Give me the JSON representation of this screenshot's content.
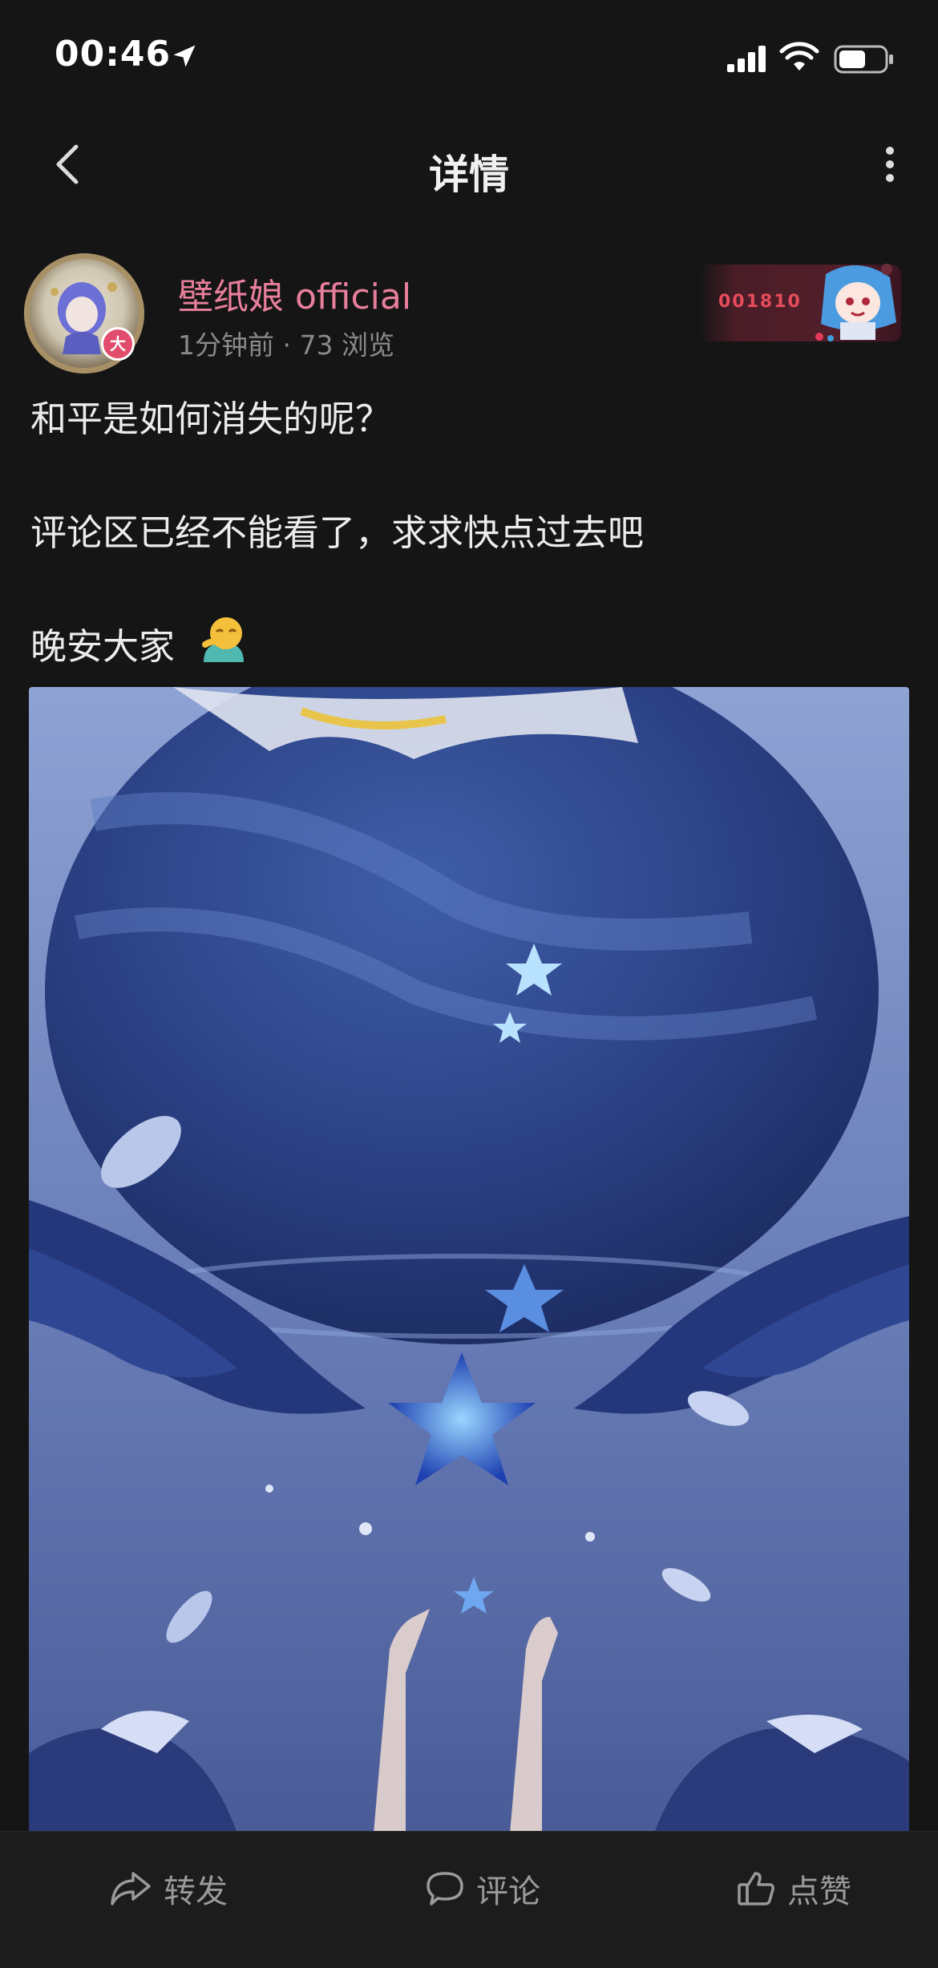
{
  "status_bar": {
    "time": "00:46",
    "battery_level": 0.6
  },
  "nav": {
    "title": "详情",
    "back_icon": "chevron-left-icon",
    "more_icon": "more-vertical-icon"
  },
  "author": {
    "name": "壁纸娘 official",
    "name_color": "#e87f9c",
    "badge": "大",
    "meta": "1分钟前 · 73 浏览",
    "medal_text": "001810"
  },
  "post": {
    "lines": [
      "和平是如何消失的呢？",
      "评论区已经不能看了，求求快点过去吧",
      "晚安大家"
    ],
    "emoji": "hugging-emoji"
  },
  "actions": {
    "share": "转发",
    "comment": "评论",
    "like": "点赞"
  }
}
